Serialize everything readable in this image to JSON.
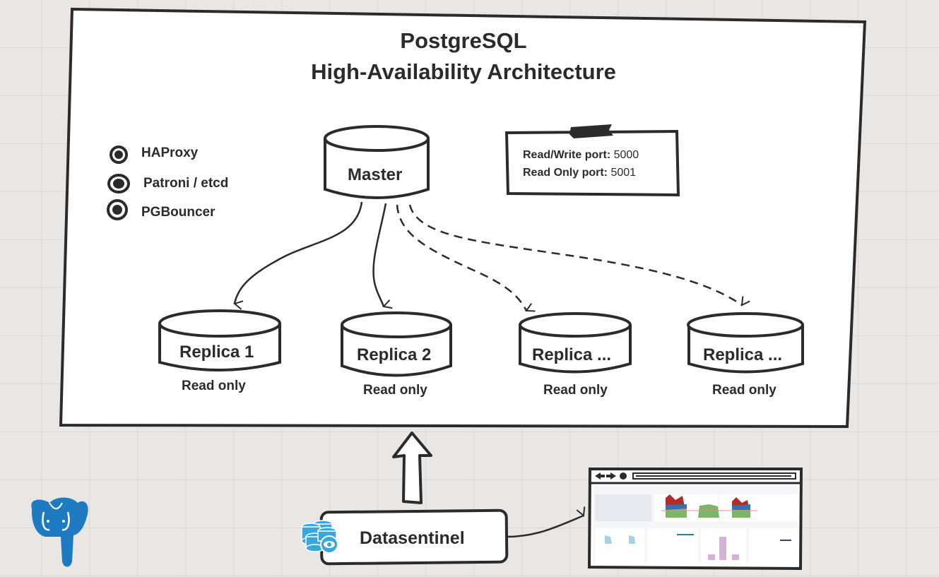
{
  "diagram": {
    "title_line1": "PostgreSQL",
    "title_line2": "High-Availability Architecture",
    "legend": [
      {
        "icon": "radio-dot-icon",
        "label": "HAProxy"
      },
      {
        "icon": "radio-dot-icon",
        "label": "Patroni / etcd"
      },
      {
        "icon": "radio-dot-icon",
        "label": "PGBouncer"
      }
    ],
    "ports_note": {
      "rw_label": "Read/Write port:",
      "rw_value": "5000",
      "ro_label": "Read Only port:",
      "ro_value": "5001"
    },
    "master": {
      "label": "Master"
    },
    "replicas": [
      {
        "label": "Replica 1",
        "caption": "Read only",
        "link": "solid"
      },
      {
        "label": "Replica 2",
        "caption": "Read only",
        "link": "solid"
      },
      {
        "label": "Replica ...",
        "caption": "Read only",
        "link": "dashed"
      },
      {
        "label": "Replica ...",
        "caption": "Read only",
        "link": "dashed"
      }
    ],
    "monitor": {
      "label": "Datasentinel",
      "icon": "database-eye-icon"
    },
    "logo": {
      "icon": "postgresql-elephant-icon"
    },
    "dashboard": {
      "icon": "browser-dashboard-thumbnail"
    },
    "colors": {
      "stroke": "#2b2b2b",
      "canvas": "#ffffff",
      "background": "#e9e6e3",
      "brand_blue": "#1f7bc1",
      "icon_blue": "#39a6dc"
    }
  }
}
